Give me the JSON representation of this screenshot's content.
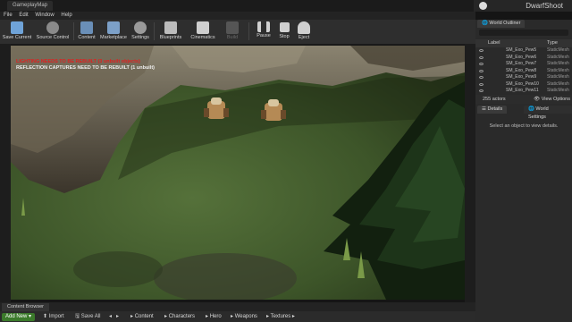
{
  "window": {
    "tab_title": "GameplayMap",
    "project_name": "DwarfShoot"
  },
  "menu": [
    "File",
    "Edit",
    "Window",
    "Help"
  ],
  "toolbar": {
    "buttons": [
      {
        "label": "Save Current",
        "icon": "save-icon",
        "color": "#6fa3d8"
      },
      {
        "label": "Source Control",
        "icon": "source-control-icon",
        "color": "#b0b0b0"
      },
      {
        "label": "Content",
        "icon": "content-icon",
        "color": "#6a8fb8"
      },
      {
        "label": "Marketplace",
        "icon": "marketplace-icon",
        "color": "#7ca0c8"
      },
      {
        "label": "Settings",
        "icon": "settings-icon",
        "color": "#bdbdbd"
      },
      {
        "label": "Blueprints",
        "icon": "blueprints-icon",
        "color": "#c0c0c0"
      },
      {
        "label": "Cinematics",
        "icon": "cinematics-icon",
        "color": "#cfcfcf"
      },
      {
        "label": "Build",
        "icon": "build-icon",
        "color": "#5a5a5a"
      },
      {
        "label": "Pause",
        "icon": "pause-icon",
        "color": "#d0d0d0"
      },
      {
        "label": "Stop",
        "icon": "stop-icon",
        "color": "#d0d0d0"
      },
      {
        "label": "Eject",
        "icon": "eject-icon",
        "color": "#d0d0d0"
      }
    ]
  },
  "viewport": {
    "warnings": [
      {
        "text": "LIGHTING NEEDS TO BE REBUILT (3 unbuilt objects)",
        "color": "#e02020"
      },
      {
        "text": "REFLECTION CAPTURES NEED TO BE REBUILT (1 unbuilt)",
        "color": "#f0f0f0"
      }
    ]
  },
  "outliner": {
    "tab": "World Outliner",
    "columns": {
      "label": "Label",
      "type": "Type"
    },
    "rows": [
      {
        "label": "SM_Exo_Pew5",
        "type": "StaticMesh"
      },
      {
        "label": "SM_Exo_Pew6",
        "type": "StaticMesh"
      },
      {
        "label": "SM_Exo_Pew7",
        "type": "StaticMesh"
      },
      {
        "label": "SM_Exo_Pew8",
        "type": "StaticMesh"
      },
      {
        "label": "SM_Exo_Pew9",
        "type": "StaticMesh"
      },
      {
        "label": "SM_Exo_Pew10",
        "type": "StaticMesh"
      },
      {
        "label": "SM_Exo_Pew11",
        "type": "StaticMesh"
      }
    ],
    "actor_count": "255 actors",
    "view_options": "View Options"
  },
  "details": {
    "tab": "Details",
    "tab2": "World Settings",
    "empty_msg": "Select an object to view details."
  },
  "content_browser": {
    "tab": "Content Browser",
    "add_new": "Add New",
    "import": "Import",
    "save_all": "Save All",
    "breadcrumb": [
      "Content",
      "Characters",
      "Hero",
      "Weapons",
      "Textures"
    ]
  }
}
